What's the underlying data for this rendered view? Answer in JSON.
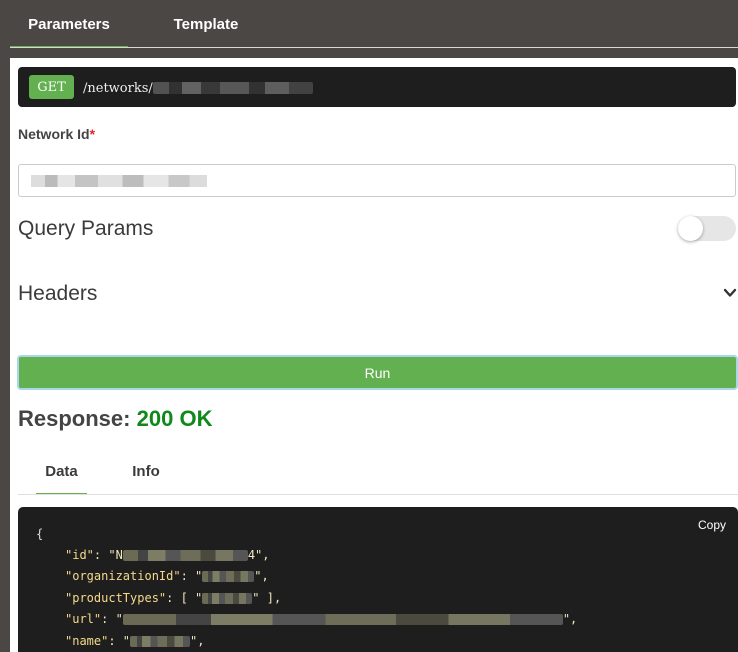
{
  "tabs": [
    {
      "label": "Parameters",
      "active": true
    },
    {
      "label": "Template",
      "active": false
    }
  ],
  "request": {
    "method": "GET",
    "path_prefix": "/networks/"
  },
  "network_id": {
    "label": "Network Id",
    "required_mark": "*"
  },
  "query_params": {
    "label": "Query Params",
    "enabled": false
  },
  "headers": {
    "label": "Headers",
    "icon": "chevron-down-icon"
  },
  "run": {
    "label": "Run"
  },
  "response": {
    "label": "Response:",
    "status_code": "200",
    "status_text": "OK"
  },
  "response_tabs": [
    {
      "label": "Data",
      "active": true
    },
    {
      "label": "Info",
      "active": false
    }
  ],
  "code": {
    "copy_label": "Copy",
    "open_brace": "{",
    "lines": [
      {
        "key": "\"id\"",
        "prefix": ": \"N",
        "suffix": "4\","
      },
      {
        "key": "\"organizationId\"",
        "prefix": ": \"",
        "suffix": "\","
      },
      {
        "key": "\"productTypes\"",
        "prefix": ": [ \"",
        "suffix": "\" ],"
      },
      {
        "key": "\"url\"",
        "prefix": ": \"",
        "suffix": "\","
      },
      {
        "key": "\"name\"",
        "prefix": ": \"",
        "suffix": "\","
      }
    ]
  },
  "colors": {
    "accent": "#62b04f",
    "status_ok": "#0f8a1a",
    "required": "#e0282d"
  }
}
